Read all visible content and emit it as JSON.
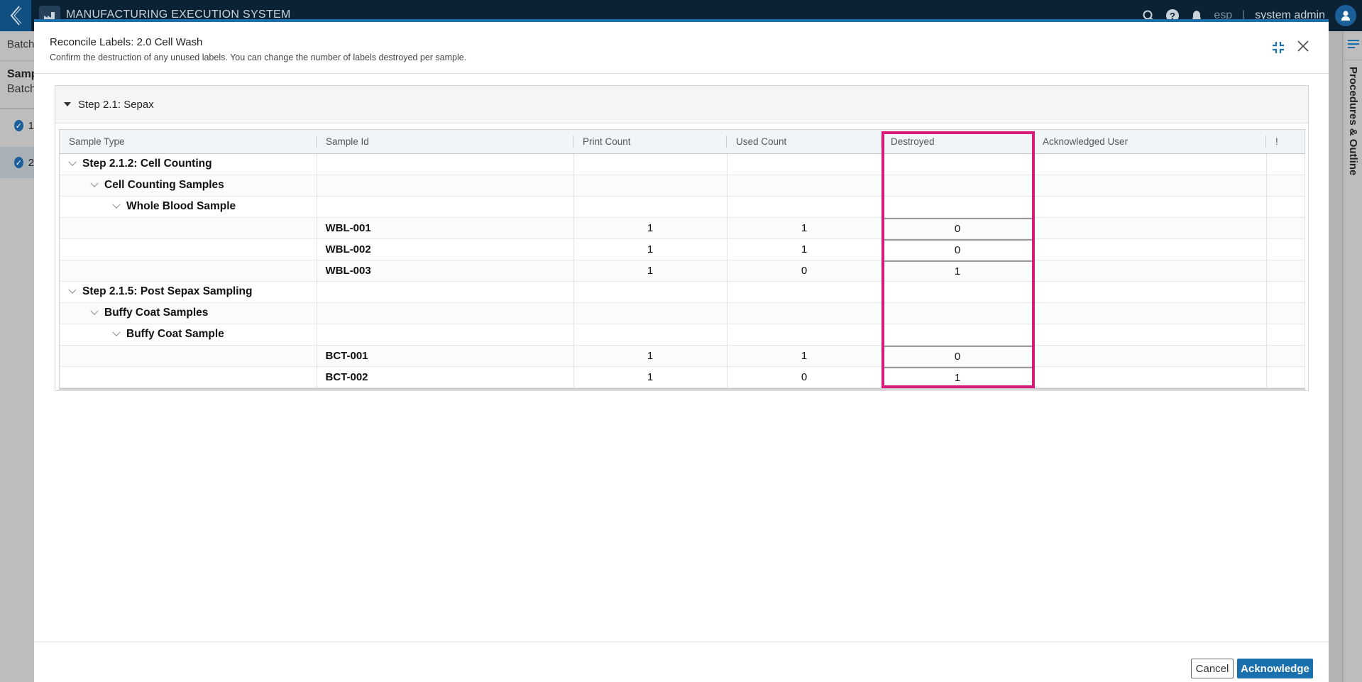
{
  "app": {
    "title": "MANUFACTURING EXECUTION SYSTEM",
    "tenant": "esp",
    "user": "system admin",
    "icons": [
      "back-chevron-icon",
      "factory-logo-icon",
      "search-icon",
      "help-icon",
      "bell-icon",
      "user-avatar-icon"
    ]
  },
  "background": {
    "breadcrumb": "Batch",
    "sample_heading": "Samp",
    "sample_sub": "Batch",
    "items": [
      {
        "label": "1",
        "status": "complete"
      },
      {
        "label": "2",
        "status": "complete",
        "active": true
      }
    ],
    "right_panel_label": "Procedures & Outline"
  },
  "modal": {
    "title": "Reconcile Labels: 2.0 Cell Wash",
    "subtitle": "Confirm the destruction of any unused labels. You can change the number of labels destroyed per sample.",
    "step": {
      "label": "Step 2.1: Sepax",
      "expanded": true
    },
    "columns": [
      "Sample Type",
      "Sample Id",
      "Print Count",
      "Used Count",
      "Destroyed",
      "Acknowledged User",
      "!"
    ],
    "rows": [
      {
        "type": "group",
        "level": 1,
        "label": "Step 2.1.2: Cell Counting"
      },
      {
        "type": "group",
        "level": 2,
        "label": "Cell Counting Samples"
      },
      {
        "type": "group",
        "level": 3,
        "label": "Whole Blood Sample"
      },
      {
        "type": "sample",
        "sample_id": "WBL-001",
        "print_count": "1",
        "used_count": "1",
        "destroyed": "0",
        "ack_user": ""
      },
      {
        "type": "sample",
        "sample_id": "WBL-002",
        "print_count": "1",
        "used_count": "1",
        "destroyed": "0",
        "ack_user": ""
      },
      {
        "type": "sample",
        "sample_id": "WBL-003",
        "print_count": "1",
        "used_count": "0",
        "destroyed": "1",
        "ack_user": ""
      },
      {
        "type": "group",
        "level": 1,
        "label": "Step 2.1.5: Post Sepax Sampling"
      },
      {
        "type": "group",
        "level": 2,
        "label": "Buffy Coat Samples"
      },
      {
        "type": "group",
        "level": 3,
        "label": "Buffy Coat Sample"
      },
      {
        "type": "sample",
        "sample_id": "BCT-001",
        "print_count": "1",
        "used_count": "1",
        "destroyed": "0",
        "ack_user": ""
      },
      {
        "type": "sample",
        "sample_id": "BCT-002",
        "print_count": "1",
        "used_count": "0",
        "destroyed": "1",
        "ack_user": ""
      }
    ],
    "cancel_label": "Cancel",
    "acknowledge_label": "Acknowledge"
  },
  "colors": {
    "accent": "#1a6fad",
    "topbar": "#0b2235",
    "highlight": "#d81b7a"
  }
}
